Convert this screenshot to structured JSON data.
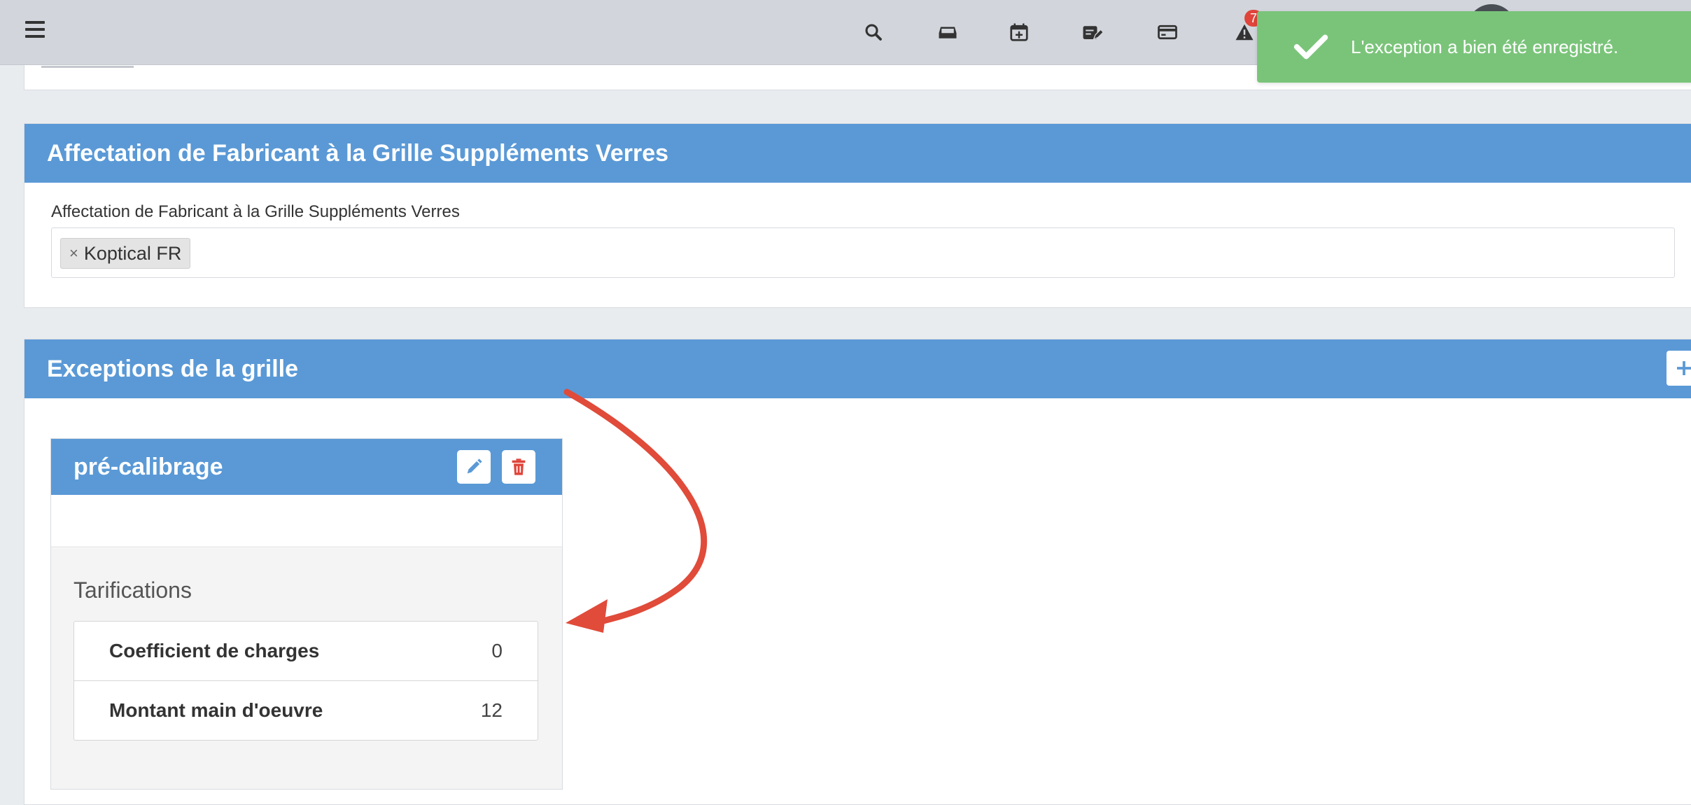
{
  "colors": {
    "accent": "#5a99d6",
    "toast": "#7ac47a",
    "annotation": "#e04b3a",
    "delete": "#e0443a"
  },
  "navbar": {
    "menu_icon": "hamburger-icon",
    "icons": [
      "search-icon",
      "inbox-icon",
      "calendar-add-icon",
      "calendar-edit-icon",
      "credit-card-icon",
      "alert-icon"
    ],
    "alert_count": "7"
  },
  "toast": {
    "icon": "check-icon",
    "message": "L'exception a bien été enregistré."
  },
  "assignment": {
    "title": "Affectation de Fabricant à la Grille Suppléments Verres",
    "field_label": "Affectation de Fabricant à la Grille Suppléments Verres",
    "selected_tag": "Koptical FR",
    "tag_remove": "×"
  },
  "exceptions": {
    "title": "Exceptions de la grille",
    "add_icon": "plus-icon",
    "items": [
      {
        "name": "pré-calibrage",
        "section_label": "Tarifications",
        "rows": [
          {
            "label": "Coefficient de charges",
            "value": "0"
          },
          {
            "label": "Montant main d'oeuvre",
            "value": "12"
          }
        ]
      }
    ]
  }
}
